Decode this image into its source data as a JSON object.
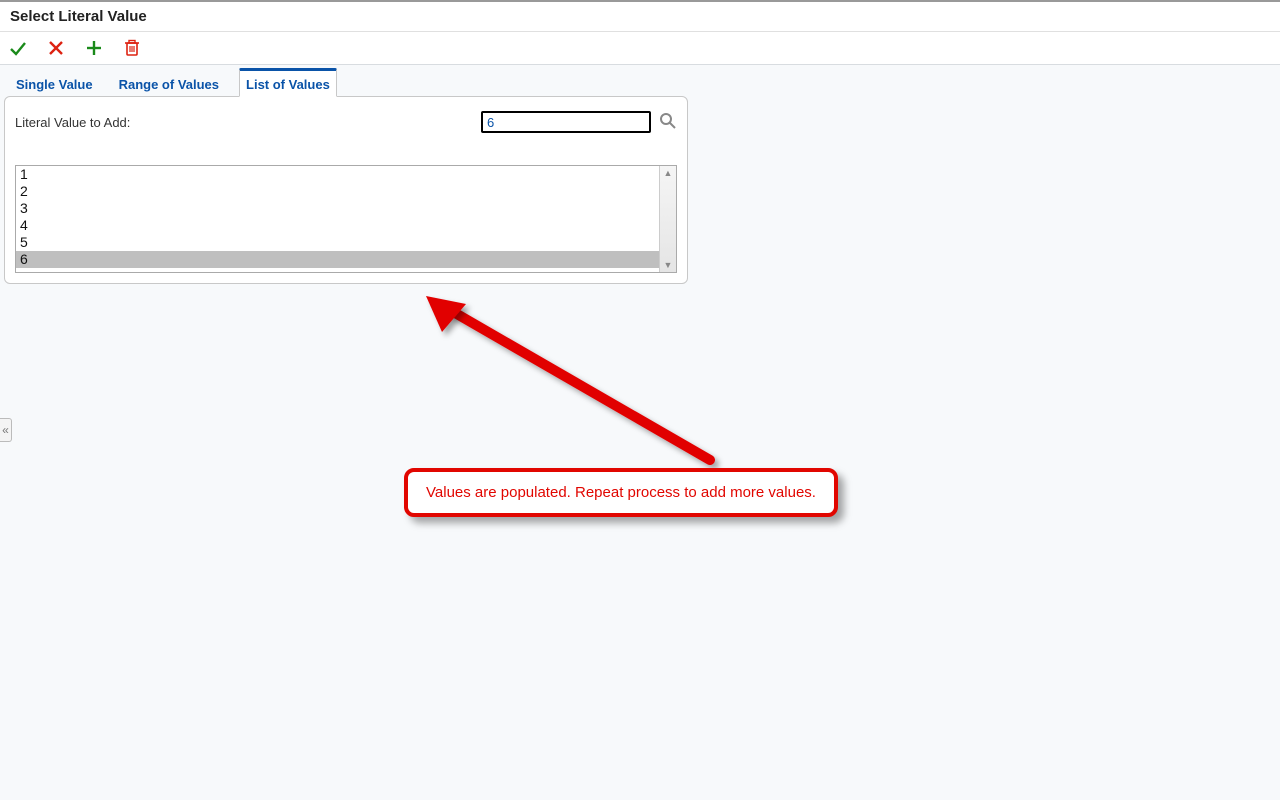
{
  "header": {
    "title": "Select Literal Value"
  },
  "toolbar": {
    "ok_label": "OK",
    "cancel_label": "Cancel",
    "add_label": "Add",
    "delete_label": "Delete"
  },
  "tabs": {
    "single": "Single Value",
    "range": "Range of Values",
    "list": "List of Values",
    "active": "list"
  },
  "form": {
    "literal_label": "Literal Value to Add:",
    "literal_value": "6",
    "search_tooltip": "Browse"
  },
  "list": {
    "items": [
      "1",
      "2",
      "3",
      "4",
      "5",
      "6"
    ],
    "selected_index": 5
  },
  "collapse": {
    "glyph": "«"
  },
  "annotation": {
    "text": "Values are populated. Repeat process to add more values."
  }
}
